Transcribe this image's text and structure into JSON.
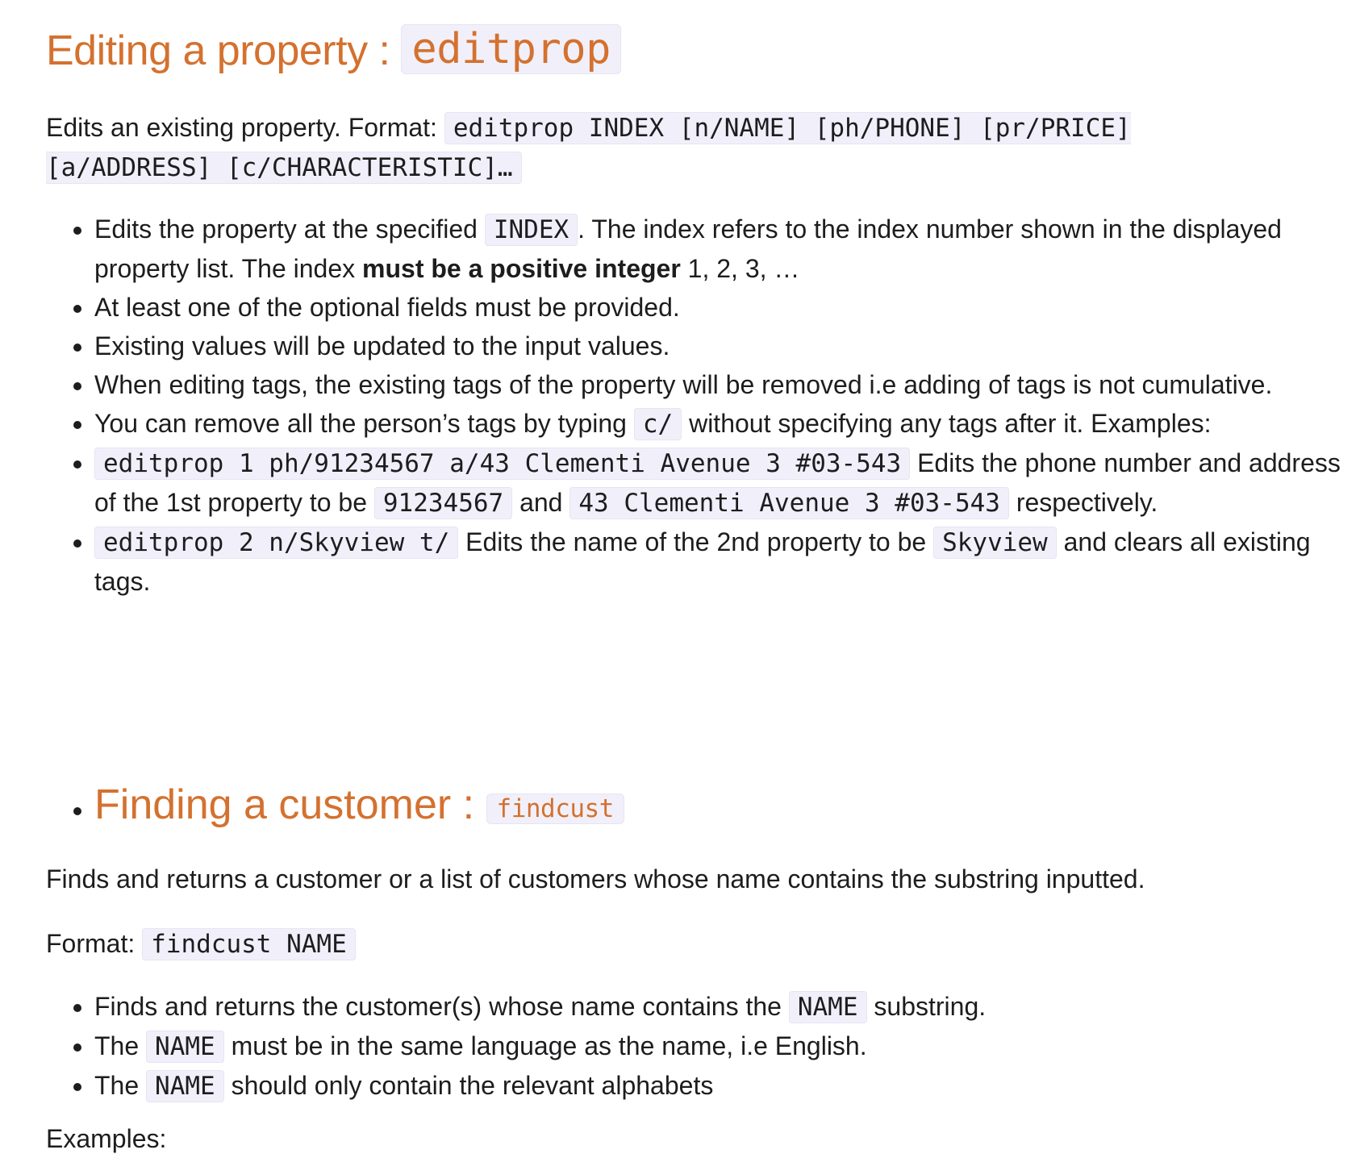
{
  "edit_section": {
    "heading_text": "Editing a property : ",
    "heading_code": "editprop",
    "format_prefix": "Edits an existing property. Format: ",
    "format_code": "editprop INDEX [n/NAME] [ph/PHONE] [pr/PRICE] [a/ADDRESS] [c/CHARACTERISTIC]…",
    "bullets": {
      "b1_a": "Edits the property at the specified ",
      "b1_code": "INDEX",
      "b1_b": ". The index refers to the index number shown in the displayed property list. The index ",
      "b1_bold": "must be a positive integer",
      "b1_c": " 1, 2, 3, …",
      "b2": "At least one of the optional fields must be provided.",
      "b3": "Existing values will be updated to the input values.",
      "b4": "When editing tags, the existing tags of the property will be removed i.e adding of tags is not cumulative.",
      "b5_a": "You can remove all the person’s tags by typing ",
      "b5_code": "c/",
      "b5_b": " without specifying any tags after it. Examples:",
      "b6_code": "editprop 1 ph/91234567 a/43 Clementi Avenue 3 #03-543",
      "b6_a": " Edits the phone number and address of the 1st property to be ",
      "b6_code2": "91234567",
      "b6_b": " and ",
      "b6_code3": "43 Clementi Avenue 3 #03-543",
      "b6_c": " respectively.",
      "b7_code": "editprop 2 n/Skyview t/",
      "b7_a": " Edits the name of the 2nd property to be ",
      "b7_code2": "Skyview",
      "b7_b": " and clears all existing tags."
    }
  },
  "find_section": {
    "heading_text": "Finding a customer : ",
    "heading_code": "findcust",
    "description": "Finds and returns a customer or a list of customers whose name contains the substring inputted.",
    "format_label": "Format: ",
    "format_code": "findcust NAME",
    "bullets": {
      "b1_a": "Finds and returns the customer(s) whose name contains the ",
      "b1_code": "NAME",
      "b1_b": " substring.",
      "b2_a": "The ",
      "b2_code": "NAME",
      "b2_b": " must be in the same language as the name, i.e English.",
      "b3_a": "The ",
      "b3_code": "NAME",
      "b3_b": " should only contain the relevant alphabets"
    },
    "examples_label": "Examples:"
  }
}
